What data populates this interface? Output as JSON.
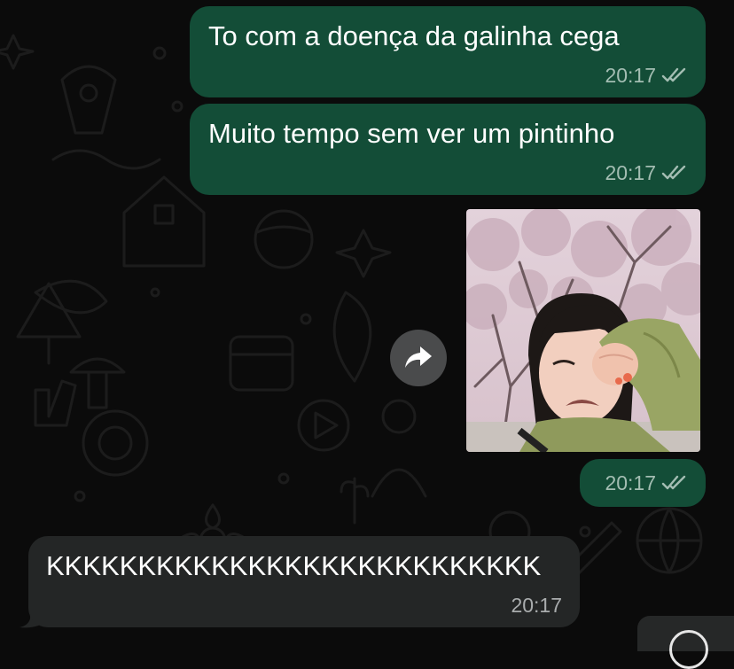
{
  "messages": [
    {
      "direction": "outgoing",
      "text": "To com a doença da galinha cega",
      "time": "20:17",
      "status": "read"
    },
    {
      "direction": "outgoing",
      "text": "Muito tempo sem ver um pintinho",
      "time": "20:17",
      "status": "read"
    },
    {
      "direction": "outgoing",
      "type": "image",
      "time": "20:17",
      "status": "read"
    },
    {
      "direction": "incoming",
      "text": "KKKKKKKKKKKKKKKKKKKKKKKKKKK",
      "time": "20:17"
    }
  ],
  "icons": {
    "read_receipt": "double-check-icon",
    "forward": "forward-arrow-icon",
    "composer": "circle-icon"
  },
  "colors": {
    "background": "#0b0b0b",
    "outgoing_bubble": "#134d37",
    "incoming_bubble": "#242626",
    "meta_text": "#a3bdb2",
    "text": "#ffffff"
  }
}
